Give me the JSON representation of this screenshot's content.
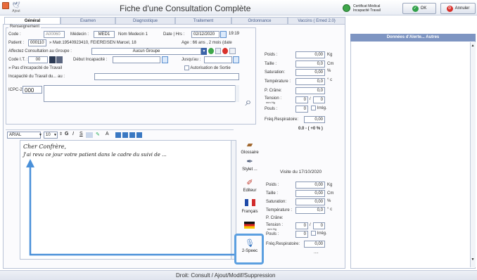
{
  "header": {
    "ajout_label": "Ajout",
    "title": "Fiche d'une Consultation Complète",
    "certificat_label_1": "Certificat Médical",
    "certificat_label_2": "Incapacité Travail",
    "ok_label": "OK",
    "annuler_label": "Annuler"
  },
  "tabs": [
    "Général",
    "Examen",
    "Diagnostique",
    "Traitement",
    "Ordonnance",
    "Vaccins ( Emed 2.0)"
  ],
  "renseignement": {
    "legend": "Renseignement",
    "code_label": "Code :",
    "code_value": "A00060",
    "medecin_label": "Médecin :",
    "medecin_value": "MED1",
    "nom_medecin": "Nom Medecin 1",
    "date_label": "Date | Hrs :",
    "date_value": "02/12/2020",
    "heure_value": "19:19",
    "patient_label": "Patient :",
    "patient_code": "000110",
    "patient_info": "» Matr.19540923410, FEIEREISEN Marcel, 18",
    "age_info": "Age : 66 ans , 2 mois (date",
    "groupe_label": "Affectez Consultation au Groupe :",
    "groupe_value": "Aucun Groupe",
    "code_it_label": "Code I.T. :",
    "code_it_value": "00",
    "debut_label": "Début Incapacité :",
    "jusquau_label": "Jusqu'au :",
    "pas_incapacite": "» Pas d'incapacité de Travail",
    "autorisation_label": "Autorisation de Sortie",
    "incapacite_du_label": "Incapacité du Travail du... au :",
    "icpc_label": "ICPC-2 :",
    "icpc_value": "000"
  },
  "vitals": {
    "poids_label": "Poids :",
    "poids_value": "0,00",
    "poids_unit": "Kg",
    "taille_label": "Taille :",
    "taille_value": "0,0",
    "taille_unit": "Cm",
    "saturation_label": "Saturation:",
    "saturation_value": "0,00",
    "saturation_unit": "%",
    "temperature_label": "Température :",
    "temperature_value": "0,0",
    "temperature_unit": "° c",
    "crane_label": "P. Crâne:",
    "crane_value": "0,0",
    "tension_label": "Tension :",
    "tension_sub": "mm Hg",
    "tension_1": "0",
    "tension_2": "0",
    "pouls_label": "Pouls :",
    "pouls_value": "0",
    "irreg_label": "Irrég.",
    "freq_label": "Fréq.Respiratoire:",
    "freq_value": "0,00",
    "imc_value": "0.0 - ( +0 % )"
  },
  "visit": {
    "title": "Visite du 17/10/2020",
    "poids_label": "Poids :",
    "poids_value": "0,00",
    "poids_unit": "Kg",
    "taille_label": "Taille :",
    "taille_value": "0,00",
    "taille_unit": "Cm",
    "saturation_label": "Saturation:",
    "saturation_value": "0,00",
    "saturation_unit": "%",
    "temperature_label": "Température :",
    "temperature_value": "0,0",
    "temperature_unit": "° c",
    "crane_label": "P. Crâne:",
    "tension_label": "Tension :",
    "tension_sub": "mm Hg",
    "tension_1": "0",
    "tension_2": "0",
    "pouls_label": "Pouls :",
    "pouls_value": "0",
    "irreg_label": "Irrég.",
    "freq_label": "Fréq.Respiratoire:",
    "freq_value": "0,00",
    "ellipsis": "...."
  },
  "editor": {
    "font_value": "ARIAL",
    "size_value": "10",
    "bold": "G",
    "italic": "I",
    "underline": "S",
    "line1": "Cher Confrère,",
    "line2": "J'ai revu ce jour votre patient dans le cadre du suivi de ..."
  },
  "side_buttons": {
    "glossaire": "Glossaire",
    "stylet": "Stylet ...",
    "editeur": "Editeur",
    "francais": "Français",
    "speech": "2-Speec"
  },
  "right_panel": {
    "header": "Données d'Alerte... Autres"
  },
  "footer": {
    "text": "Droit: Consult / Ajout/Modif/Suppression"
  },
  "colors": {
    "accent": "#3a78c2",
    "panel_header": "#7e95c2",
    "highlight": "#5b9fe0"
  }
}
